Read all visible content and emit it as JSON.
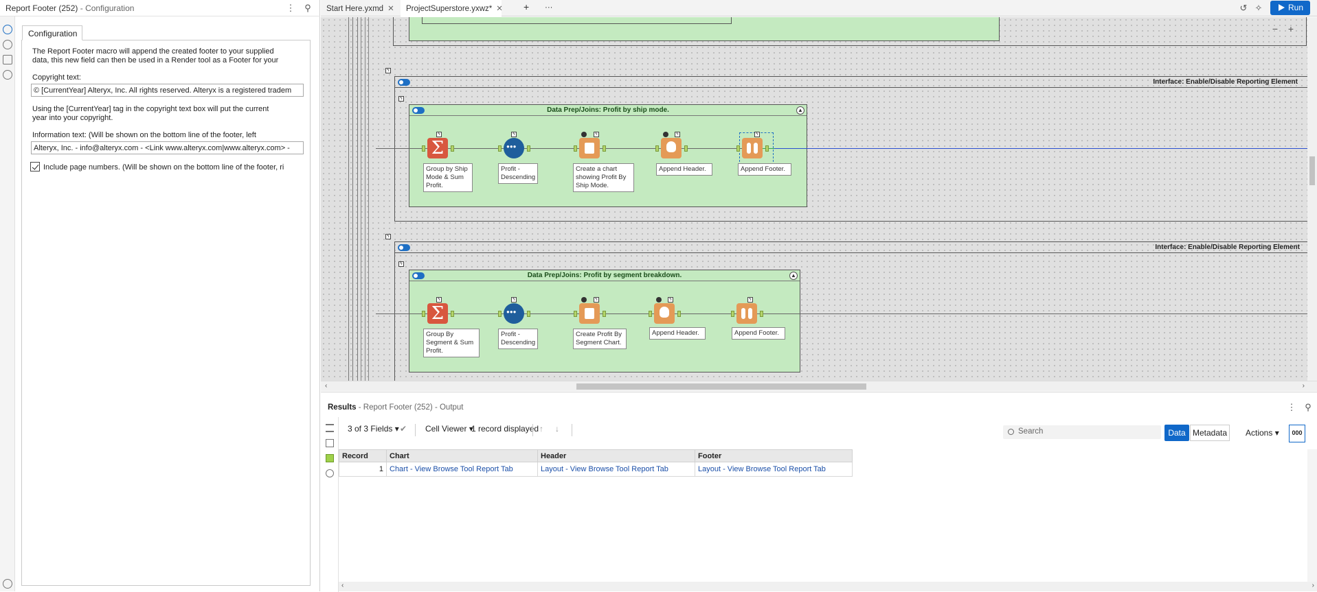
{
  "left_panel": {
    "title": "Report Footer (252)",
    "subtitle": "- Configuration",
    "tab_label": "Configuration",
    "description_line1": "The Report Footer macro will append the created footer to your supplied",
    "description_line2": "data, this new field can then be used in a Render tool as a Footer for your",
    "copyright_label": "Copyright text:",
    "copyright_value": "© [CurrentYear] Alteryx, Inc.  All rights reserved. Alteryx is a registered tradem",
    "help_line1": "Using the [CurrentYear] tag in the copyright text box will put the current",
    "help_line2": "year into your copyright.",
    "info_label": "Information text: (Will be shown on the bottom line of the footer, left",
    "info_value": "Alteryx, Inc. - info@alteryx.com - <Link www.alteryx.com|www.alteryx.com>  -",
    "checkbox_label": "Include page numbers. (Will be shown on the bottom line of the footer, ri",
    "checkbox_checked": true
  },
  "tabs": [
    {
      "label": "Start Here.yxmd",
      "active": false
    },
    {
      "label": "ProjectSuperstore.yxwz*",
      "active": true
    }
  ],
  "tab_controls": {
    "close": "✕",
    "add": "+",
    "more": "···"
  },
  "run_label": "Run",
  "canvas": {
    "zoom_out": "−",
    "zoom_in": "+",
    "containers": [
      {
        "title": "Interface: Enable/Disable Reporting Element"
      },
      {
        "title": "Interface: Enable/Disable Reporting Element"
      }
    ],
    "groups": [
      {
        "title": "Data Prep/Joins: Profit by ship mode.",
        "tools": [
          {
            "icon": "summarize-icon",
            "label": "Group by Ship Mode & Sum Profit."
          },
          {
            "icon": "sort-icon",
            "label": "Profit - Descending"
          },
          {
            "icon": "chart-icon",
            "label": "Create a chart showing Profit By Ship Mode."
          },
          {
            "icon": "report-header-icon",
            "label": "Append Header."
          },
          {
            "icon": "report-footer-icon",
            "label": "Append Footer."
          }
        ]
      },
      {
        "title": "Data Prep/Joins: Profit by segment breakdown.",
        "tools": [
          {
            "icon": "summarize-icon",
            "label": "Group By Segment & Sum Profit."
          },
          {
            "icon": "sort-icon",
            "label": "Profit - Descending"
          },
          {
            "icon": "chart-icon",
            "label": "Create Profit By Segment Chart."
          },
          {
            "icon": "report-header-icon",
            "label": "Append Header."
          },
          {
            "icon": "report-footer-icon",
            "label": "Append Footer."
          }
        ]
      }
    ]
  },
  "results": {
    "title": "Results",
    "subtitle": "- Report Footer (252) - Output",
    "fields_label": "3 of 3 Fields",
    "viewer_label": "Cell Viewer",
    "records_label": "1 record displayed",
    "search_placeholder": "Search",
    "data_btn": "Data",
    "metadata_btn": "Metadata",
    "actions_label": "Actions",
    "ooo_label": "000",
    "columns": [
      "Record",
      "Chart",
      "Header",
      "Footer"
    ],
    "rows": [
      [
        "1",
        "Chart - View Browse Tool Report Tab",
        "Layout - View Browse Tool Report Tab",
        "Layout - View Browse Tool Report Tab"
      ]
    ]
  },
  "colors": {
    "accent": "#1068c9",
    "container_green": "#c4eac0",
    "canvas_bg": "#e0e0e0"
  }
}
